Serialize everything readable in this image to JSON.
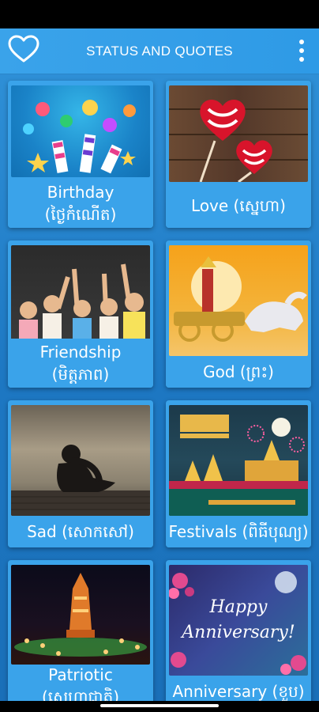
{
  "app": {
    "title": "STATUS AND QUOTES"
  },
  "icons": {
    "favorite": "heart-outline-icon",
    "menu": "more-vertical-icon"
  },
  "colors": {
    "app_bar": "#3aa3ea",
    "background": "#1d77c2",
    "card": "#3aa3ea",
    "text": "#ffffff"
  },
  "categories": [
    {
      "line1": "Birthday",
      "line2": "(ថ្ងៃកំណើត)"
    },
    {
      "line1": "Love (ស្នេហា)",
      "line2": ""
    },
    {
      "line1": "Friendship",
      "line2": "(មិត្តភាព)"
    },
    {
      "line1": "God (ព្រះ)",
      "line2": ""
    },
    {
      "line1": "Sad (សោកសៅ)",
      "line2": ""
    },
    {
      "line1": "Festivals (ពិធីបុណ្យ)",
      "line2": ""
    },
    {
      "line1": "Patriotic",
      "line2": "(ស្នេហាជាតិ)"
    },
    {
      "line1": "Anniversary (ខួប)",
      "line2": ""
    }
  ],
  "image_text": {
    "anniversary_happy": "Happy",
    "anniversary_word": "Anniversary!"
  }
}
